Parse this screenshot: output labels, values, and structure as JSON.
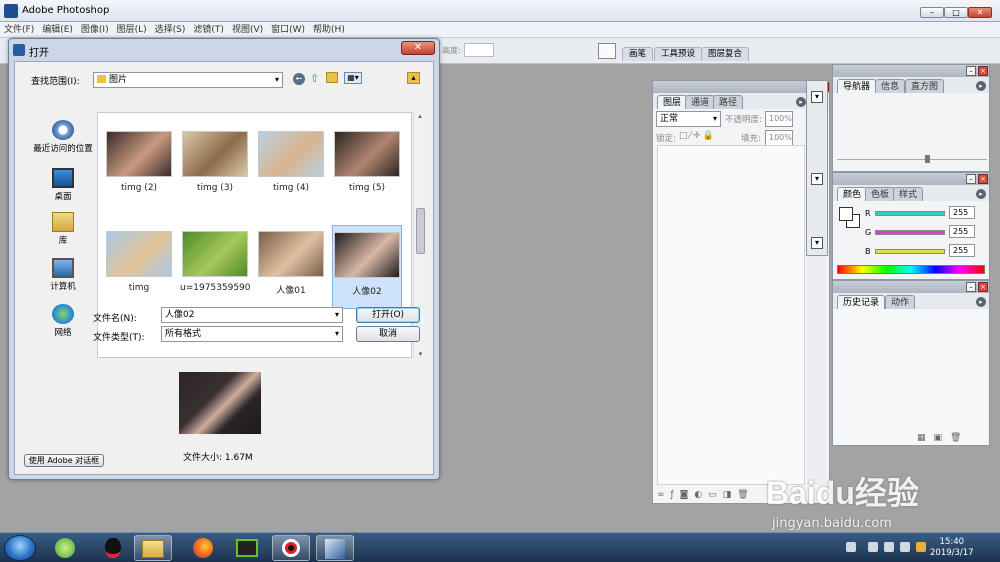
{
  "app": {
    "title": "Adobe Photoshop",
    "window_buttons": [
      "–",
      "□",
      "✕"
    ]
  },
  "menu": [
    "文件(F)",
    "编辑(E)",
    "图像(I)",
    "图层(L)",
    "选择(S)",
    "滤镜(T)",
    "视图(V)",
    "窗口(W)",
    "帮助(H)"
  ],
  "optbar": {
    "height_label": "高度:",
    "tabs": [
      "画笔",
      "工具预设",
      "图层复合"
    ]
  },
  "layers_panel": {
    "tabs": [
      "图层",
      "通道",
      "路径"
    ],
    "blend_mode": "正常",
    "opacity_label": "不透明度:",
    "opacity_value": "100%",
    "lock_label": "锁定:",
    "fill_label": "填充:",
    "fill_value": "100%"
  },
  "nav_panel": {
    "tabs": [
      "导航器",
      "信息",
      "直方图"
    ]
  },
  "color_panel": {
    "tabs": [
      "颜色",
      "色板",
      "样式"
    ],
    "channels": [
      {
        "label": "R",
        "value": "255",
        "color": "#37c7c7"
      },
      {
        "label": "G",
        "value": "255",
        "color": "#d93fd0"
      },
      {
        "label": "B",
        "value": "255",
        "color": "#e0df3b"
      }
    ]
  },
  "history_panel": {
    "tabs": [
      "历史记录",
      "动作"
    ]
  },
  "dialog": {
    "title": "打开",
    "close": "✕",
    "look_in_label": "查找范围(I):",
    "look_in_value": "图片",
    "places": [
      "最近访问的位置",
      "桌面",
      "库",
      "计算机",
      "网络"
    ],
    "files": [
      {
        "name": "timg (2)",
        "colors": [
          "#3a2c27",
          "#c99a82"
        ]
      },
      {
        "name": "timg (3)",
        "colors": [
          "#d9c9a8",
          "#8e6b4c"
        ]
      },
      {
        "name": "timg (4)",
        "colors": [
          "#b9d1e7",
          "#d8b48c"
        ]
      },
      {
        "name": "timg (5)",
        "colors": [
          "#2f2522",
          "#b08570"
        ]
      },
      {
        "name": "timg",
        "colors": [
          "#a9c9e6",
          "#e2c497"
        ]
      },
      {
        "name": "u=1975359590...",
        "colors": [
          "#4f8a2b",
          "#a7c95a"
        ]
      },
      {
        "name": "人像01",
        "colors": [
          "#7a5d47",
          "#e0c1a3"
        ]
      },
      {
        "name": "人像02",
        "colors": [
          "#1f1b1d",
          "#d9b8a6"
        ]
      }
    ],
    "selected_index": 7,
    "filename_label": "文件名(N):",
    "filename_value": "人像02",
    "filetype_label": "文件类型(T):",
    "filetype_value": "所有格式",
    "open_button": "打开(O)",
    "cancel_button": "取消",
    "file_size": "文件大小: 1.67M",
    "adobe_dialog_button": "使用 Adobe 对话框"
  },
  "taskbar": {
    "time": "15:40",
    "date": "2019/3/17"
  },
  "watermark": {
    "brand": "Baidu经验",
    "url": "jingyan.baidu.com"
  }
}
